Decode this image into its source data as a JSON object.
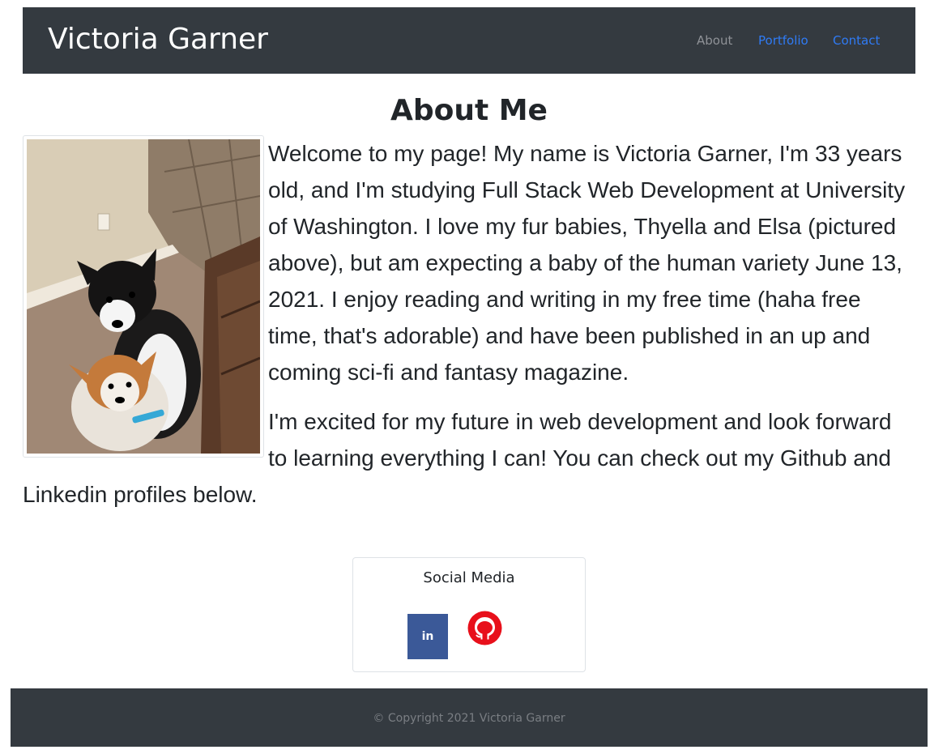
{
  "navbar": {
    "brand": "Victoria Garner",
    "links": [
      {
        "label": "About"
      },
      {
        "label": "Portfolio"
      },
      {
        "label": "Contact"
      }
    ]
  },
  "about": {
    "heading": "About Me",
    "paragraphs": [
      "Welcome to my page! My name is Victoria Garner, I'm 33 years old, and I'm studying Full Stack Web Development at University of Washington. I love my fur babies, Thyella and Elsa (pictured above), but am expecting a baby of the human variety June 13, 2021. I enjoy reading and writing in my free time (haha free time, that's adorable) and have been published in an up and coming sci-fi and fantasy magazine.",
      "I'm excited for my future in web development and look forward to learning everything I can! You can check out my Github and Linkedin profiles below."
    ]
  },
  "social": {
    "title": "Social Media",
    "linkedin_label": "in"
  },
  "footer": {
    "copyright": "© Copyright 2021 Victoria Garner"
  },
  "colors": {
    "navbar_bg": "#343a40",
    "link_active": "#2f7bf5",
    "linkedin_bg": "#3b5998",
    "github_red": "#e8101b"
  },
  "icons": {
    "linkedin": "linkedin-icon",
    "github": "github-icon"
  }
}
